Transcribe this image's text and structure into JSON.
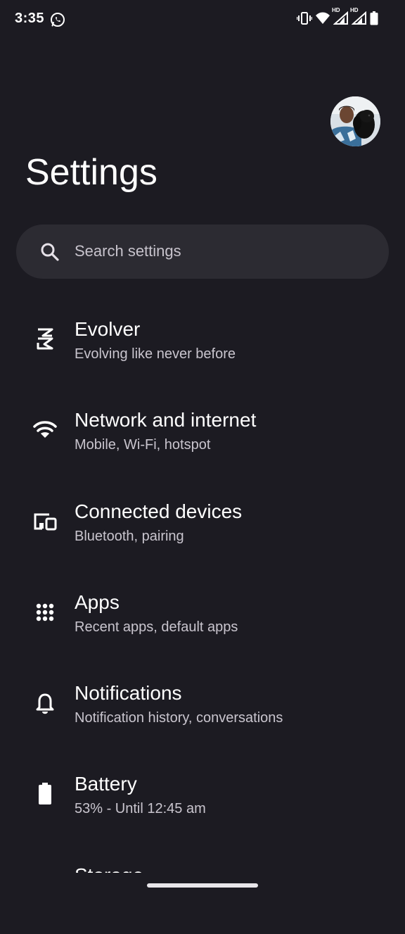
{
  "status_bar": {
    "time": "3:35",
    "icons": [
      "whatsapp-icon",
      "vibrate-icon",
      "wifi-icon",
      "signal-hd-icon",
      "signal-hd-icon",
      "battery-icon"
    ],
    "hd_label": "HD"
  },
  "header": {
    "title": "Settings",
    "avatar": "profile-avatar"
  },
  "search": {
    "placeholder": "Search settings",
    "icon": "search-icon"
  },
  "settings_items": [
    {
      "icon": "evolver-logo-icon",
      "title": "Evolver",
      "subtitle": "Evolving like never before"
    },
    {
      "icon": "wifi-icon",
      "title": "Network and internet",
      "subtitle": "Mobile, Wi-Fi, hotspot"
    },
    {
      "icon": "devices-icon",
      "title": "Connected devices",
      "subtitle": "Bluetooth, pairing"
    },
    {
      "icon": "apps-grid-icon",
      "title": "Apps",
      "subtitle": "Recent apps, default apps"
    },
    {
      "icon": "bell-icon",
      "title": "Notifications",
      "subtitle": "Notification history, conversations"
    },
    {
      "icon": "battery-icon",
      "title": "Battery",
      "subtitle": "53% - Until 12:45 am"
    },
    {
      "icon": "storage-icon",
      "title": "Storage",
      "subtitle": ""
    }
  ],
  "colors": {
    "background": "#1c1b22",
    "search_bg": "#2c2b32",
    "text_primary": "#ffffff",
    "text_secondary": "#c9c5ce"
  }
}
